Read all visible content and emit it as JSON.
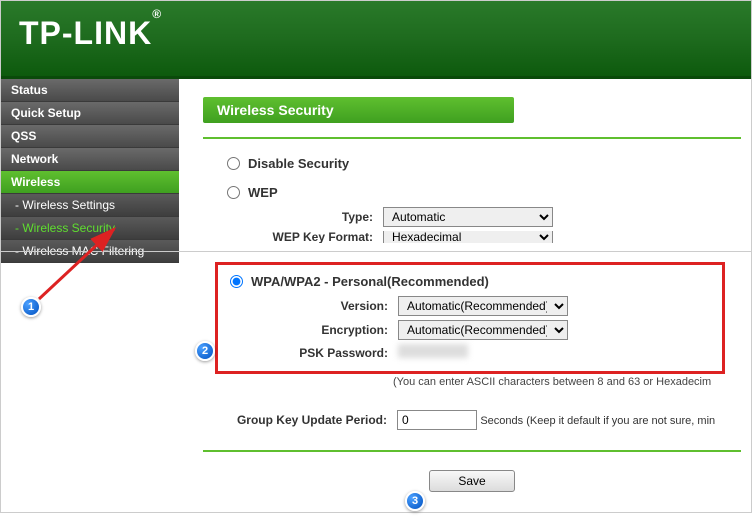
{
  "brand": "TP-LINK",
  "sidebar": {
    "items": [
      {
        "label": "Status"
      },
      {
        "label": "Quick Setup"
      },
      {
        "label": "QSS"
      },
      {
        "label": "Network"
      },
      {
        "label": "Wireless"
      },
      {
        "label": "- Wireless Settings"
      },
      {
        "label": "- Wireless Security"
      },
      {
        "label": "- Wireless MAC Filtering"
      }
    ]
  },
  "page_title": "Wireless Security",
  "disable_security_label": "Disable Security",
  "wep": {
    "label": "WEP",
    "type_label": "Type:",
    "type_value": "Automatic",
    "keyfmt_label": "WEP Key Format:",
    "keyfmt_value": "Hexadecimal"
  },
  "wpa": {
    "label": "WPA/WPA2 - Personal(Recommended)",
    "version_label": "Version:",
    "version_value": "Automatic(Recommended)",
    "encryption_label": "Encryption:",
    "encryption_value": "Automatic(Recommended)",
    "psk_label": "PSK Password:",
    "psk_hint": "(You can enter ASCII characters between 8 and 63 or Hexadecim",
    "group_key_label": "Group Key Update Period:",
    "group_key_value": "0",
    "group_key_hint": "Seconds (Keep it default if you are not sure, min"
  },
  "save_label": "Save",
  "markers": {
    "m1": "1",
    "m2": "2",
    "m3": "3"
  }
}
